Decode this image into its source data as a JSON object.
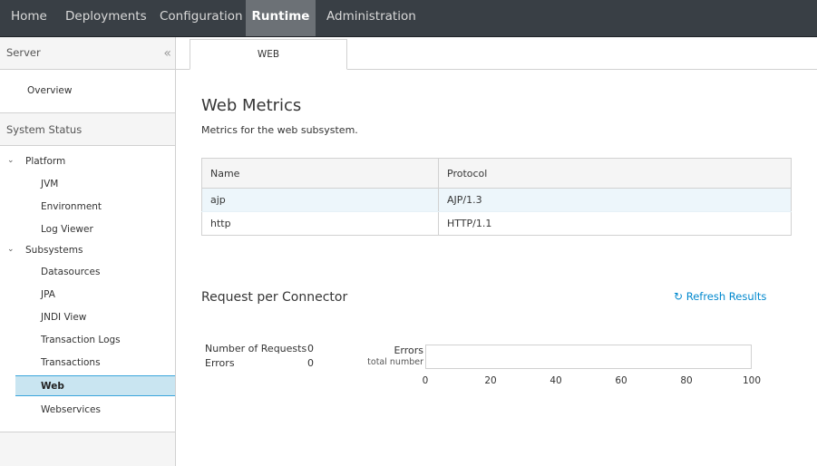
{
  "topnav": {
    "items": [
      "Home",
      "Deployments",
      "Configuration",
      "Runtime",
      "Administration"
    ],
    "active": "Runtime"
  },
  "sidebar": {
    "server_header": "Server",
    "collapse_icon": "double-chevron-left-icon",
    "overview": "Overview",
    "system_status_header": "System Status",
    "platform": {
      "label": "Platform",
      "items": [
        "JVM",
        "Environment",
        "Log Viewer"
      ]
    },
    "subsystems": {
      "label": "Subsystems",
      "items": [
        "Datasources",
        "JPA",
        "JNDI View",
        "Transaction Logs",
        "Transactions",
        "Web",
        "Webservices"
      ],
      "selected": "Web"
    }
  },
  "main": {
    "tab_label": "WEB",
    "title": "Web Metrics",
    "description": "Metrics for the web subsystem.",
    "table": {
      "headers": [
        "Name",
        "Protocol"
      ],
      "rows": [
        {
          "name": "ajp",
          "protocol": "AJP/1.3",
          "selected": true
        },
        {
          "name": "http",
          "protocol": "HTTP/1.1",
          "selected": false
        }
      ]
    },
    "request_section": {
      "title": "Request per Connector",
      "refresh_label": "Refresh Results",
      "refresh_icon": "refresh-icon",
      "stats": [
        {
          "label": "Number of Requests",
          "value": "0"
        },
        {
          "label": "Errors",
          "value": "0"
        }
      ],
      "bar": {
        "label": "Errors",
        "sublabel": "total number",
        "value": 0,
        "max": 100,
        "ticks": [
          "0",
          "20",
          "40",
          "60",
          "80",
          "100"
        ],
        "fill_color": "#39a5dc"
      }
    }
  }
}
